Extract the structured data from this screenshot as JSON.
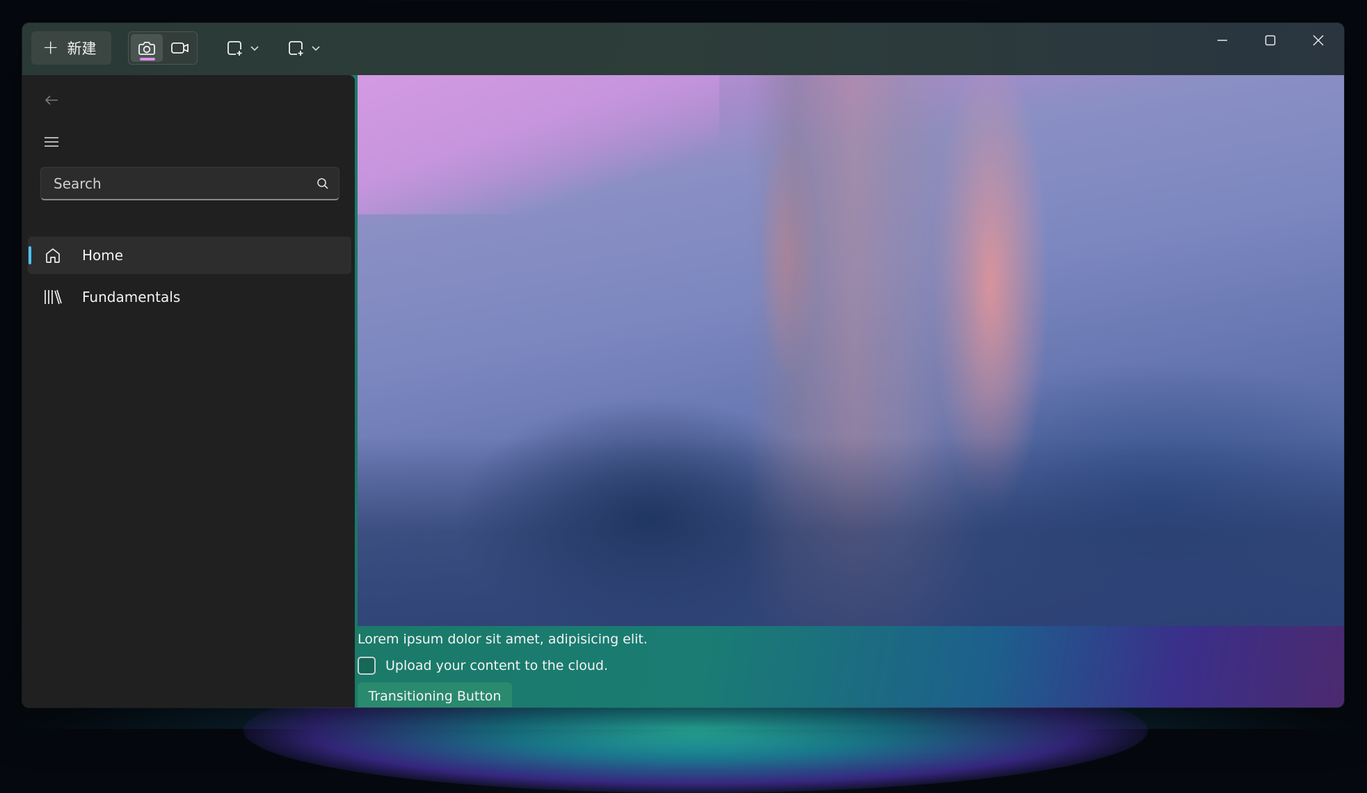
{
  "titlebar": {
    "new_label": "新建",
    "plus_glyph": "+"
  },
  "sidebar": {
    "search": {
      "placeholder": "Search"
    },
    "items": [
      {
        "label": "Home",
        "icon": "home-icon",
        "selected": true
      },
      {
        "label": "Fundamentals",
        "icon": "library-icon",
        "selected": false
      }
    ],
    "accent": "#4cc2ff"
  },
  "content": {
    "caption": "Lorem ipsum dolor sit amet, adipisicing elit.",
    "checkbox_label": "Upload your content to the cloud.",
    "checkbox_checked": false,
    "button_label": "Transitioning Button"
  },
  "colors": {
    "capture_mode_indicator": "#d991e6",
    "sidebar_background": "#202020"
  }
}
